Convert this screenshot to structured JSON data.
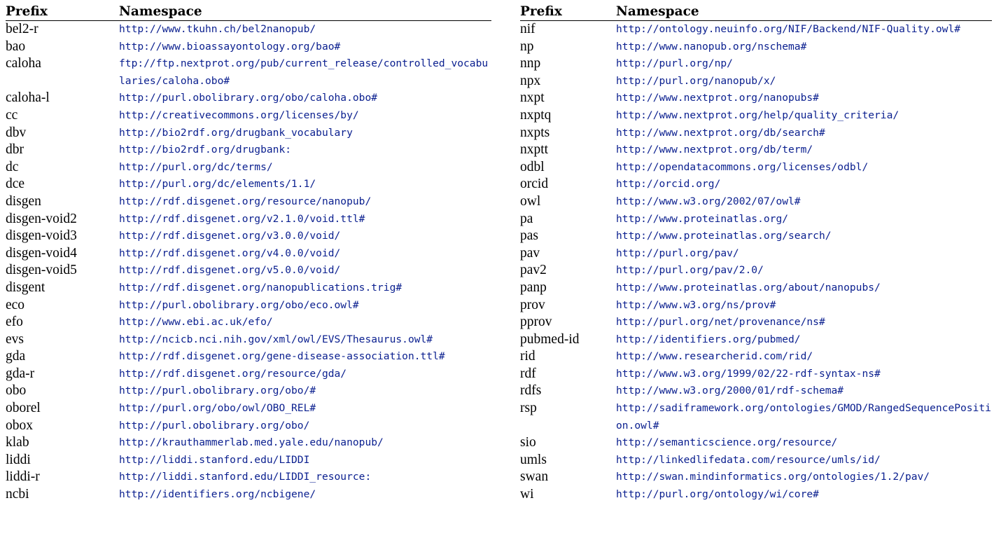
{
  "headers": {
    "prefix": "Prefix",
    "namespace": "Namespace"
  },
  "left_rows": [
    {
      "prefix": "bel2-r",
      "ns": "http://www.tkuhn.ch/bel2nanopub/"
    },
    {
      "prefix": "bao",
      "ns": "http://www.bioassayontology.org/bao#"
    },
    {
      "prefix": "caloha",
      "ns": "ftp://ftp.nextprot.org/pub/current_release/controlled_vocabularies/caloha.obo#"
    },
    {
      "prefix": "caloha-l",
      "ns": "http://purl.obolibrary.org/obo/caloha.obo#"
    },
    {
      "prefix": "cc",
      "ns": "http://creativecommons.org/licenses/by/"
    },
    {
      "prefix": "dbv",
      "ns": "http://bio2rdf.org/drugbank_vocabulary"
    },
    {
      "prefix": "dbr",
      "ns": "http://bio2rdf.org/drugbank:"
    },
    {
      "prefix": "dc",
      "ns": "http://purl.org/dc/terms/"
    },
    {
      "prefix": "dce",
      "ns": "http://purl.org/dc/elements/1.1/"
    },
    {
      "prefix": "disgen",
      "ns": "http://rdf.disgenet.org/resource/nanopub/"
    },
    {
      "prefix": "disgen-void2",
      "ns": "http://rdf.disgenet.org/v2.1.0/void.ttl#"
    },
    {
      "prefix": "disgen-void3",
      "ns": "http://rdf.disgenet.org/v3.0.0/void/"
    },
    {
      "prefix": "disgen-void4",
      "ns": "http://rdf.disgenet.org/v4.0.0/void/"
    },
    {
      "prefix": "disgen-void5",
      "ns": "http://rdf.disgenet.org/v5.0.0/void/"
    },
    {
      "prefix": "disgent",
      "ns": "http://rdf.disgenet.org/nanopublications.trig#"
    },
    {
      "prefix": "eco",
      "ns": "http://purl.obolibrary.org/obo/eco.owl#"
    },
    {
      "prefix": "efo",
      "ns": "http://www.ebi.ac.uk/efo/"
    },
    {
      "prefix": "evs",
      "ns": "http://ncicb.nci.nih.gov/xml/owl/EVS/Thesaurus.owl#"
    },
    {
      "prefix": "gda",
      "ns": "http://rdf.disgenet.org/gene-disease-association.ttl#"
    },
    {
      "prefix": "gda-r",
      "ns": "http://rdf.disgenet.org/resource/gda/"
    },
    {
      "prefix": "obo",
      "ns": "http://purl.obolibrary.org/obo/#"
    },
    {
      "prefix": "oborel",
      "ns": "http://purl.org/obo/owl/OBO_REL#"
    },
    {
      "prefix": "obox",
      "ns": "http://purl.obolibrary.org/obo/"
    },
    {
      "prefix": "klab",
      "ns": "http://krauthammerlab.med.yale.edu/nanopub/"
    },
    {
      "prefix": "liddi",
      "ns": "http://liddi.stanford.edu/LIDDI"
    },
    {
      "prefix": "liddi-r",
      "ns": "http://liddi.stanford.edu/LIDDI_resource:"
    },
    {
      "prefix": "ncbi",
      "ns": "http://identifiers.org/ncbigene/"
    }
  ],
  "right_rows": [
    {
      "prefix": "nif",
      "ns": "http://ontology.neuinfo.org/NIF/Backend/NIF-Quality.owl#"
    },
    {
      "prefix": "np",
      "ns": "http://www.nanopub.org/nschema#"
    },
    {
      "prefix": "nnp",
      "ns": "http://purl.org/np/"
    },
    {
      "prefix": "npx",
      "ns": "http://purl.org/nanopub/x/"
    },
    {
      "prefix": "nxpt",
      "ns": "http://www.nextprot.org/nanopubs#"
    },
    {
      "prefix": "nxptq",
      "ns": "http://www.nextprot.org/help/quality_criteria/"
    },
    {
      "prefix": "nxpts",
      "ns": "http://www.nextprot.org/db/search#"
    },
    {
      "prefix": "nxptt",
      "ns": "http://www.nextprot.org/db/term/"
    },
    {
      "prefix": "odbl",
      "ns": "http://opendatacommons.org/licenses/odbl/"
    },
    {
      "prefix": "orcid",
      "ns": "http://orcid.org/"
    },
    {
      "prefix": "owl",
      "ns": "http://www.w3.org/2002/07/owl#"
    },
    {
      "prefix": "pa",
      "ns": "http://www.proteinatlas.org/"
    },
    {
      "prefix": "pas",
      "ns": "http://www.proteinatlas.org/search/"
    },
    {
      "prefix": "pav",
      "ns": "http://purl.org/pav/"
    },
    {
      "prefix": "pav2",
      "ns": "http://purl.org/pav/2.0/"
    },
    {
      "prefix": "panp",
      "ns": "http://www.proteinatlas.org/about/nanopubs/"
    },
    {
      "prefix": "prov",
      "ns": "http://www.w3.org/ns/prov#"
    },
    {
      "prefix": "pprov",
      "ns": "http://purl.org/net/provenance/ns#"
    },
    {
      "prefix": "pubmed-id",
      "ns": "http://identifiers.org/pubmed/"
    },
    {
      "prefix": "rid",
      "ns": "http://www.researcherid.com/rid/"
    },
    {
      "prefix": "rdf",
      "ns": "http://www.w3.org/1999/02/22-rdf-syntax-ns#"
    },
    {
      "prefix": "rdfs",
      "ns": "http://www.w3.org/2000/01/rdf-schema#"
    },
    {
      "prefix": "rsp",
      "ns": "http://sadiframework.org/ontologies/GMOD/RangedSequencePosition.owl#"
    },
    {
      "prefix": "sio",
      "ns": "http://semanticscience.org/resource/"
    },
    {
      "prefix": "umls",
      "ns": "http://linkedlifedata.com/resource/umls/id/"
    },
    {
      "prefix": "swan",
      "ns": "http://swan.mindinformatics.org/ontologies/1.2/pav/"
    },
    {
      "prefix": "wi",
      "ns": "http://purl.org/ontology/wi/core#"
    }
  ]
}
